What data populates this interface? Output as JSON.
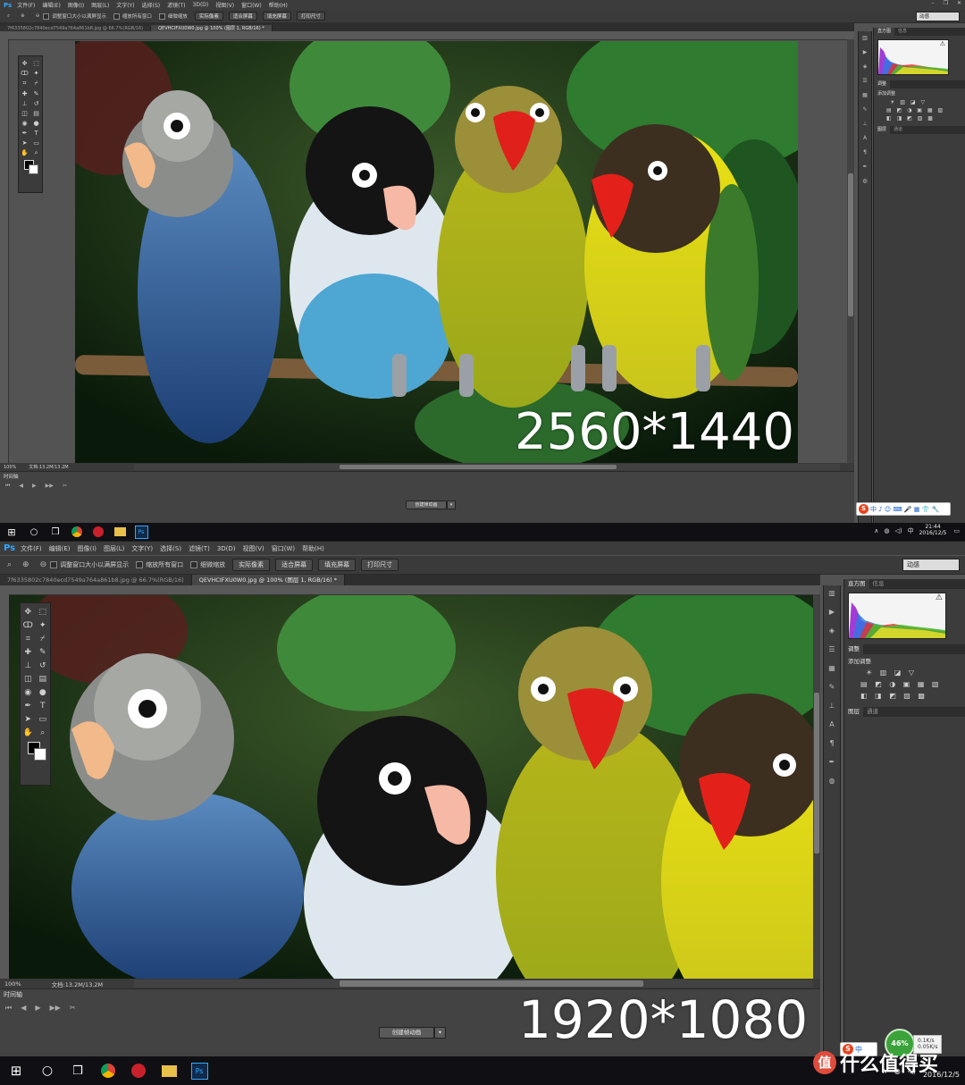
{
  "app": {
    "logo": "Ps",
    "menu_labels": [
      "文件(F)",
      "编辑(E)",
      "图像(I)",
      "图层(L)",
      "文字(Y)",
      "选择(S)",
      "滤镜(T)",
      "3D(D)",
      "视图(V)",
      "窗口(W)",
      "帮助(H)"
    ],
    "options": {
      "checkbox_resize_windows": "调整窗口大小以满屏显示",
      "checkbox_zoom_all": "缩放所有窗口",
      "checkbox_scrubby": "细微缩放",
      "btn_actual_pixels": "实际像素",
      "btn_fit_screen": "适合屏幕",
      "btn_fill_screen": "填充屏幕",
      "btn_print_size": "打印尺寸",
      "workspace": "动感"
    },
    "tabs": [
      "7f6335802c7840ecd7549a764a861b8.jpg @ 66.7%(RGB/16)",
      "QEVHCIFXU0W0.jpg @ 100% (图层 1, RGB/16) *"
    ],
    "status": {
      "zoom": "100%",
      "doc_size": "文档:13.2M/13.2M"
    },
    "timeline": {
      "title": "时间轴",
      "create_button": "创建帧动画"
    },
    "panels": {
      "histogram_tab": "直方图",
      "info_tab": "信息",
      "adjustments_tab": "调整",
      "add_adjustment": "添加调整",
      "layers_tab": "图层",
      "channels_tab": "通道"
    }
  },
  "top": {
    "resolution": "2560*1440",
    "clock_time": "21:44",
    "clock_date": "2016/12/5"
  },
  "bottom": {
    "resolution": "1920*1080",
    "clock_date": "2016/12/5",
    "net": {
      "percent": "46%",
      "up": "0.1K/s",
      "down": "0.05K/s"
    },
    "watermark": "什么值得买",
    "watermark_badge": "值"
  },
  "ime": {
    "logo": "S",
    "text": "中 ♪ ☺ ⌨ 🎤 ▦ 👕 🔧"
  },
  "tray_cn": "中",
  "icons": {
    "search": "search-icon",
    "task_view": "task-view-icon",
    "chrome": "chrome-icon",
    "explorer": "folder-icon",
    "photoshop": "photoshop-icon",
    "zoom_tool": "zoom-icon"
  }
}
